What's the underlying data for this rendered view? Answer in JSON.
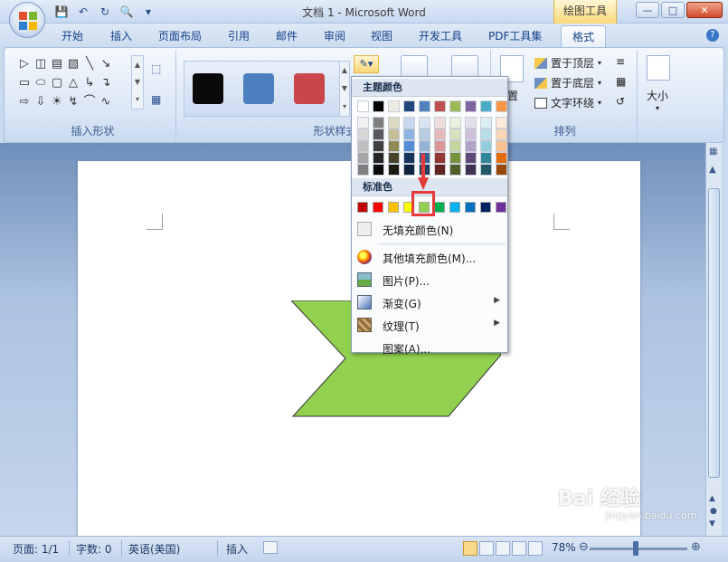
{
  "window": {
    "title": "文档 1 - Microsoft Word",
    "context_tool": "绘图工具"
  },
  "tabs": [
    {
      "label": "开始"
    },
    {
      "label": "插入"
    },
    {
      "label": "页面布局"
    },
    {
      "label": "引用"
    },
    {
      "label": "邮件"
    },
    {
      "label": "审阅"
    },
    {
      "label": "视图"
    },
    {
      "label": "开发工具"
    },
    {
      "label": "PDF工具集"
    },
    {
      "label": "格式",
      "active": true
    }
  ],
  "ribbon": {
    "groups": {
      "insert_shapes": "插入形状",
      "shape_styles": "形状样式",
      "arrange": "排列",
      "size": "大小"
    },
    "style_swatches": [
      "#0a0a0a",
      "#4b7fbf",
      "#c9474a"
    ],
    "arrange_items": [
      {
        "label": "置于顶层"
      },
      {
        "label": "置于底层"
      },
      {
        "label": "文字环绕"
      }
    ],
    "position_label": "置"
  },
  "fill_dropdown": {
    "theme_header": "主题颜色",
    "standard_header": "标准色",
    "theme_top_row": [
      "#ffffff",
      "#000000",
      "#eeece1",
      "#1f497d",
      "#4f81bd",
      "#c0504d",
      "#9bbb59",
      "#8064a2",
      "#4bacc6",
      "#f79646"
    ],
    "theme_shades": [
      [
        "#f2f2f2",
        "#7f7f7f",
        "#ddd9c3",
        "#c6d9f0",
        "#dbe5f1",
        "#f2dcdb",
        "#ebf1dd",
        "#e5e0ec",
        "#dbeef3",
        "#fdeada"
      ],
      [
        "#d8d8d8",
        "#595959",
        "#c4bd97",
        "#8db3e2",
        "#b8cce4",
        "#e5b9b7",
        "#d7e3bc",
        "#ccc1d9",
        "#b7dde8",
        "#fbd5b5"
      ],
      [
        "#bfbfbf",
        "#3f3f3f",
        "#938953",
        "#548dd4",
        "#95b3d7",
        "#d99694",
        "#c3d69b",
        "#b2a2c7",
        "#92cddc",
        "#fac08f"
      ],
      [
        "#a5a5a5",
        "#262626",
        "#494429",
        "#17365d",
        "#366092",
        "#953734",
        "#76923c",
        "#5f497a",
        "#31859b",
        "#e36c09"
      ],
      [
        "#7f7f7f",
        "#0c0c0c",
        "#1d1b10",
        "#0f243e",
        "#244061",
        "#632423",
        "#4f6128",
        "#3f3151",
        "#205867",
        "#974806"
      ]
    ],
    "standard_colors": [
      "#c00000",
      "#ff0000",
      "#ffc000",
      "#ffff00",
      "#92d050",
      "#00b050",
      "#00b0f0",
      "#0070c0",
      "#002060",
      "#7030a0"
    ],
    "selected_standard_index": 4,
    "menu_items": [
      {
        "label": "无填充颜色(N)",
        "icon": "no-fill-icon"
      },
      {
        "label": "其他填充颜色(M)...",
        "icon": "palette-icon"
      },
      {
        "label": "图片(P)...",
        "icon": "picture-icon"
      },
      {
        "label": "渐变(G)",
        "icon": "gradient-icon",
        "submenu": true
      },
      {
        "label": "纹理(T)",
        "icon": "texture-icon",
        "submenu": true
      },
      {
        "label": "图案(A)...",
        "icon": "pattern-icon"
      }
    ]
  },
  "document": {
    "shape_color": "#92d050"
  },
  "status": {
    "page": "页面: 1/1",
    "words": "字数: 0",
    "language": "英语(美国)",
    "mode": "插入",
    "zoom": "78%"
  },
  "watermark": {
    "brand": "Bai 经验",
    "url": "jingyan.baidu.com"
  }
}
